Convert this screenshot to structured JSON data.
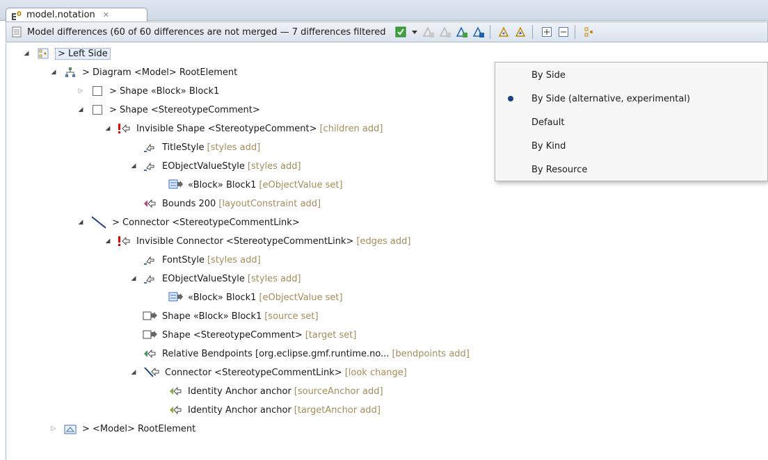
{
  "tab": {
    "title": "model.notation",
    "icon": "notation-file-icon",
    "close_icon": "close-icon"
  },
  "header": {
    "title": "Model differences  (60 of 60 differences are not merged — 7 differences filtered",
    "icon": "document-icon"
  },
  "toolbar": [
    "filter-check-icon",
    "dropdown-arrow-icon",
    "accept-left-icon",
    "accept-right-icon",
    "merge-left-icon",
    "merge-right-icon",
    "next-diff-icon",
    "previous-diff-icon",
    "expand-all-icon",
    "collapse-all-icon",
    "group-by-icon"
  ],
  "tree": [
    {
      "indent": 0,
      "twisty": "open",
      "icon": "group-side-icon",
      "label": "> Left Side",
      "hint": "",
      "selected": true
    },
    {
      "indent": 1,
      "twisty": "open",
      "icon": "diagram-icon",
      "label": "> Diagram <Model> RootElement",
      "hint": ""
    },
    {
      "indent": 2,
      "twisty": "closed",
      "icon": "shape-icon",
      "label": "> Shape «Block» Block1",
      "hint": ""
    },
    {
      "indent": 2,
      "twisty": "open",
      "icon": "shape-icon",
      "label": "> Shape <StereotypeComment>",
      "hint": ""
    },
    {
      "indent": 3,
      "twisty": "open",
      "icon": "conflict-add-icon",
      "label": "Invisible Shape <StereotypeComment>",
      "hint": "[children add]"
    },
    {
      "indent": 4,
      "twisty": "none",
      "icon": "style-add-icon",
      "label": "TitleStyle",
      "hint": "[styles add]"
    },
    {
      "indent": 4,
      "twisty": "open",
      "icon": "style-add-icon",
      "label": "EObjectValueStyle",
      "hint": "[styles add]"
    },
    {
      "indent": 5,
      "twisty": "none",
      "icon": "value-set-icon",
      "label": "«Block» Block1",
      "hint": "[eObjectValue set]"
    },
    {
      "indent": 4,
      "twisty": "none",
      "icon": "bounds-add-icon",
      "label": "Bounds 200",
      "hint": "[layoutConstraint add]"
    },
    {
      "indent": 2,
      "twisty": "open",
      "icon": "connector-icon",
      "label": "> Connector <StereotypeCommentLink>",
      "hint": ""
    },
    {
      "indent": 3,
      "twisty": "open",
      "icon": "conflict-add-icon",
      "label": "Invisible Connector <StereotypeCommentLink>",
      "hint": "[edges add]"
    },
    {
      "indent": 4,
      "twisty": "none",
      "icon": "style-add-icon",
      "label": "FontStyle",
      "hint": "[styles add]"
    },
    {
      "indent": 4,
      "twisty": "open",
      "icon": "style-add-icon",
      "label": "EObjectValueStyle",
      "hint": "[styles add]"
    },
    {
      "indent": 5,
      "twisty": "none",
      "icon": "value-set-icon",
      "label": "«Block» Block1",
      "hint": "[eObjectValue set]"
    },
    {
      "indent": 4,
      "twisty": "none",
      "icon": "shape-set-icon",
      "label": "Shape «Block» Block1",
      "hint": "[source set]"
    },
    {
      "indent": 4,
      "twisty": "none",
      "icon": "shape-set-icon",
      "label": "Shape <StereotypeComment>",
      "hint": "[target set]"
    },
    {
      "indent": 4,
      "twisty": "none",
      "icon": "bendpoints-add-icon",
      "label": "Relative Bendpoints [org.eclipse.gmf.runtime.no...",
      "hint": "[bendpoints add]"
    },
    {
      "indent": 4,
      "twisty": "open",
      "icon": "connector-change-icon",
      "label": "Connector <StereotypeCommentLink>",
      "hint": "[look change]"
    },
    {
      "indent": 5,
      "twisty": "none",
      "icon": "anchor-add-icon",
      "label": "Identity Anchor anchor",
      "hint": "[sourceAnchor add]"
    },
    {
      "indent": 5,
      "twisty": "none",
      "icon": "anchor-add-icon",
      "label": "Identity Anchor anchor",
      "hint": "[targetAnchor add]"
    },
    {
      "indent": 1,
      "twisty": "closed",
      "icon": "model-icon",
      "label": "> <Model> RootElement",
      "hint": ""
    }
  ],
  "menu": {
    "items": [
      {
        "label": "By Side",
        "checked": false
      },
      {
        "label": "By Side (alternative, experimental)",
        "checked": true
      },
      {
        "label": "Default",
        "checked": false
      },
      {
        "label": "By Kind",
        "checked": false
      },
      {
        "label": "By Resource",
        "checked": false
      }
    ]
  },
  "colors": {
    "hint": "#a68c5a",
    "conflict": "#e00000",
    "header_bg": "#dbe3ee",
    "accent": "#2a5db0"
  }
}
